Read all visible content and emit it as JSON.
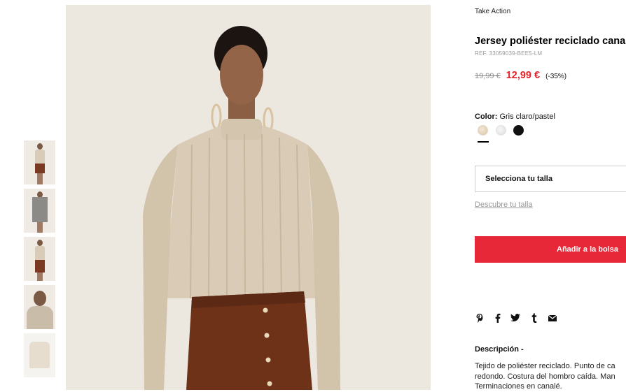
{
  "brand_link": "Take Action",
  "product": {
    "title": "Jersey poliéster reciclado canalé",
    "ref": "REF. 33059039-BEE5-LM",
    "old_price": "19,99 €",
    "new_price": "12,99 €",
    "discount": "(-35%)"
  },
  "color": {
    "label": "Color:",
    "value": "Gris claro/pastel",
    "swatches": [
      {
        "name": "beige",
        "color": "#e3d4bc"
      },
      {
        "name": "light-grey",
        "color": "#e6e6e6"
      },
      {
        "name": "black",
        "color": "#111111"
      }
    ]
  },
  "size": {
    "select_label": "Selecciona tu talla",
    "guide_link": "Descubre tu talla"
  },
  "cart": {
    "add_label": "Añadir a la bolsa",
    "accent": "#e72838"
  },
  "share_icons": [
    "pinterest-icon",
    "facebook-icon",
    "twitter-icon",
    "tumblr-icon",
    "email-icon"
  ],
  "description": {
    "title": "Descripción -",
    "lines": [
      "Tejido de poliéster reciclado. Punto de ca",
      "redondo. Costura del hombro caída. Man",
      "Terminaciones en canalé."
    ]
  },
  "colors": {
    "sale_red": "#e4202a",
    "photo_background": "#ece7df"
  }
}
